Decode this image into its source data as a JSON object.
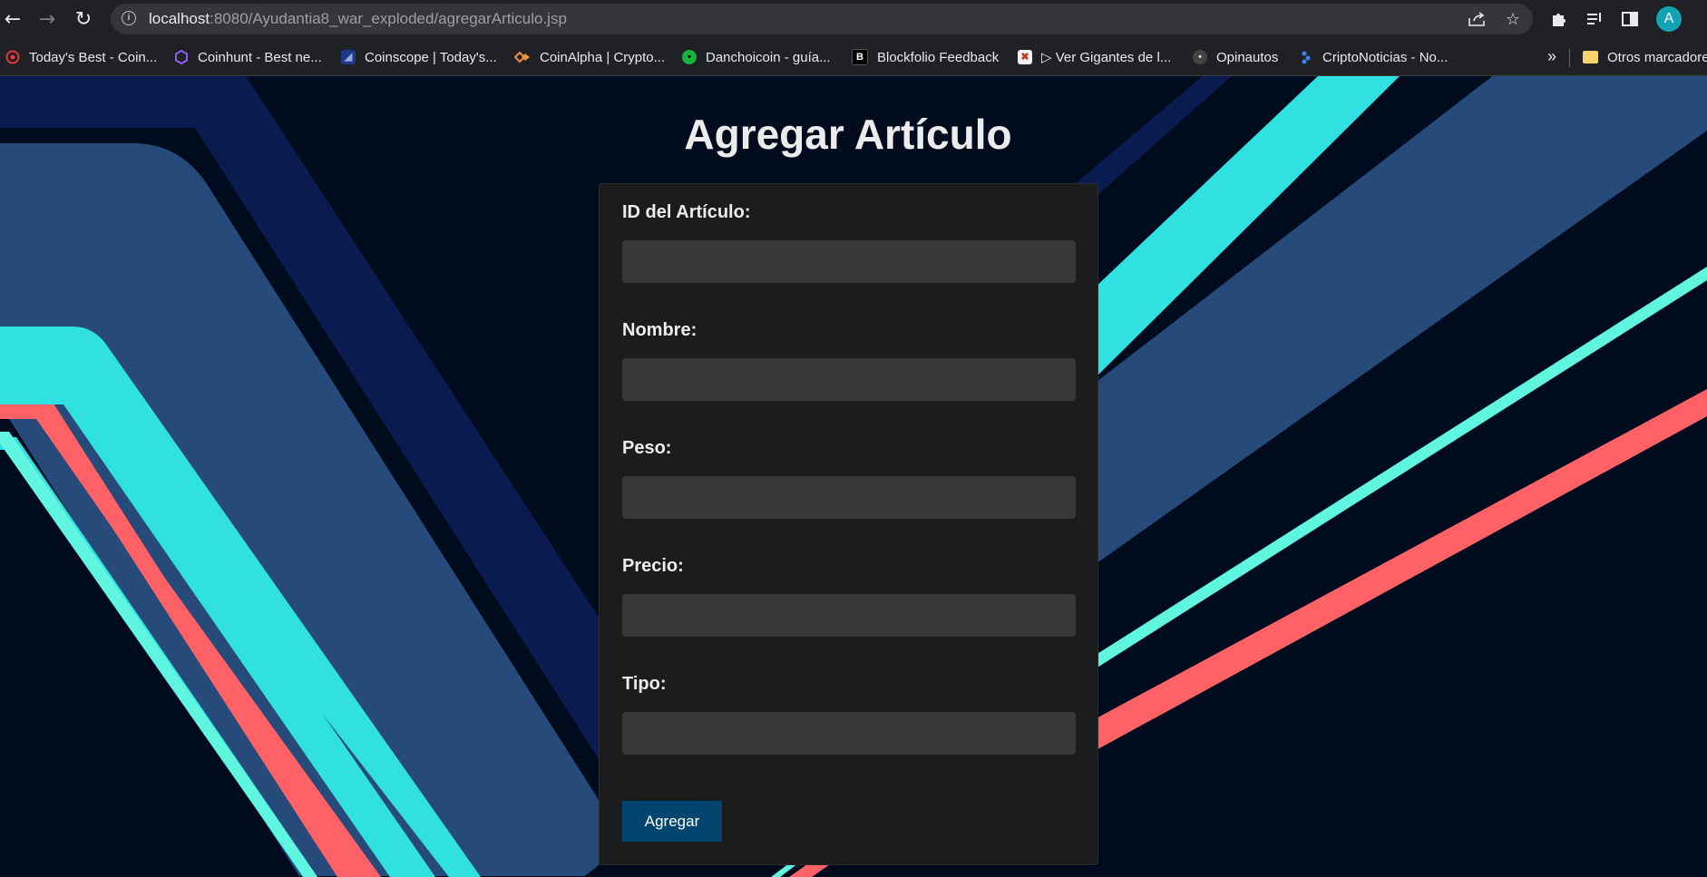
{
  "browser": {
    "url_host": "localhost",
    "url_path": ":8080/Ayudantia8_war_exploded/agregarArticulo.jsp",
    "profile_initial": "A",
    "bookmarks": [
      {
        "label": "Today's Best - Coin...",
        "icon": "target-favicon"
      },
      {
        "label": "Coinhunt - Best ne...",
        "icon": "coinhunt-favicon"
      },
      {
        "label": "Coinscope | Today's...",
        "icon": "coinscope-favicon"
      },
      {
        "label": "CoinAlpha | Crypto...",
        "icon": "coinalpha-favicon"
      },
      {
        "label": "Danchoicoin - guía...",
        "icon": "danchoicoin-favicon"
      },
      {
        "label": "Blockfolio Feedback",
        "icon": "blockfolio-favicon"
      },
      {
        "label": "▷ Ver Gigantes de l...",
        "icon": "gigantes-favicon"
      },
      {
        "label": "Opinautos",
        "icon": "opinautos-favicon"
      },
      {
        "label": "CriptoNoticias - No...",
        "icon": "criptonoticias-favicon"
      }
    ],
    "more_bookmarks": "»",
    "other_bookmarks": "Otros marcadores"
  },
  "page": {
    "title": "Agregar Artículo",
    "fields": [
      {
        "label": "ID del Artículo:",
        "value": ""
      },
      {
        "label": "Nombre:",
        "value": ""
      },
      {
        "label": "Peso:",
        "value": ""
      },
      {
        "label": "Precio:",
        "value": ""
      },
      {
        "label": "Tipo:",
        "value": ""
      }
    ],
    "submit_label": "Agregar"
  },
  "colors": {
    "background": "#000c1e",
    "card": "#1b1c1e",
    "input": "#383838",
    "button": "#024670",
    "stripe_cyan": "#31e0e0",
    "stripe_red": "#ff6266",
    "stripe_blue": "#264a7a",
    "stripe_navy": "#0a1b50"
  }
}
